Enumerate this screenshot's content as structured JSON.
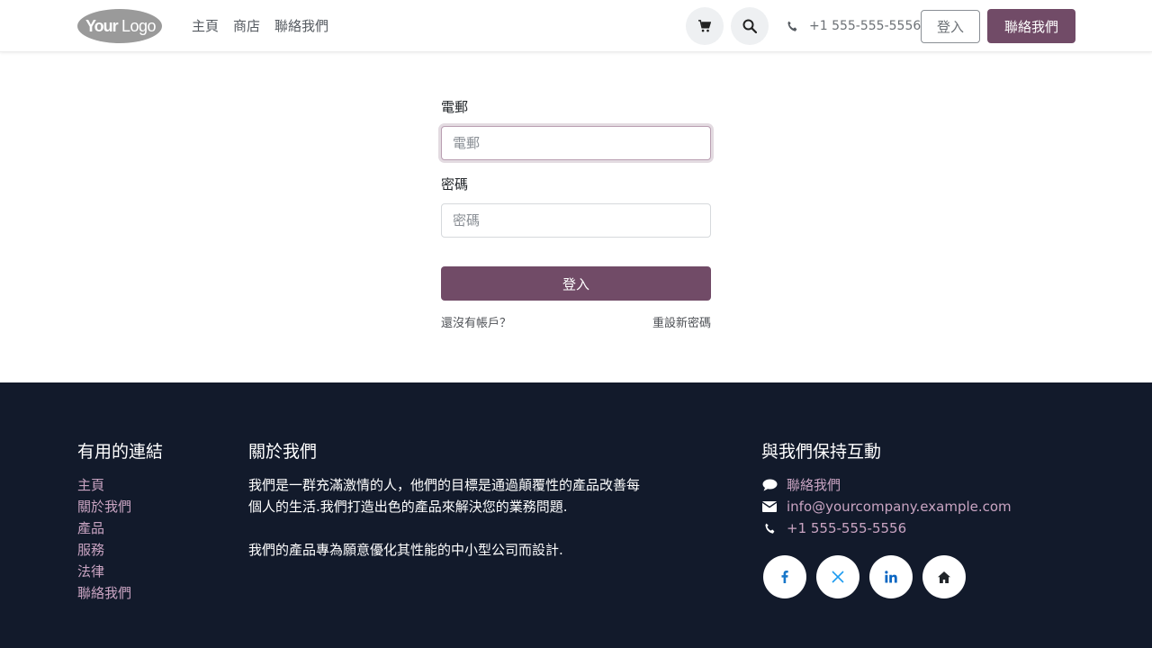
{
  "header": {
    "logo_text": "YourLogo",
    "nav": [
      "主頁",
      "商店",
      "聯絡我們"
    ],
    "phone": "+1 555-555-5556",
    "login_label": "登入",
    "contact_label": "聯絡我們",
    "cart_icon": "cart-icon",
    "search_icon": "search-icon"
  },
  "form": {
    "email_label": "電郵",
    "email_placeholder": "電郵",
    "email_value": "",
    "password_label": "密碼",
    "password_placeholder": "密碼",
    "password_value": "",
    "submit_label": "登入",
    "no_account_link": "還沒有帳戶？",
    "reset_password_link": "重設新密碼"
  },
  "footer": {
    "links_title": "有用的連結",
    "links": [
      "主頁",
      "關於我們",
      "產品",
      "服務",
      "法律",
      "聯絡我們"
    ],
    "about_title": "關於我們",
    "about_p1": "我們是一群充滿激情的人，他們的目標是通過顛覆性的產品改善每個人的生活.我們打造出色的產品來解決您的業務問題.",
    "about_p2": "我們的產品專為願意優化其性能的中小型公司而設計.",
    "contact_title": "與我們保持互動",
    "contact_link": "聯絡我們",
    "email": "info@yourcompany.example.com",
    "phone": "+1 555-555-5556",
    "social": [
      "facebook-icon",
      "x-twitter-icon",
      "linkedin-icon",
      "home-icon"
    ]
  },
  "colors": {
    "brand": "#714b67",
    "footer_bg": "#121a2b",
    "footer_link": "#c9a4c2"
  }
}
